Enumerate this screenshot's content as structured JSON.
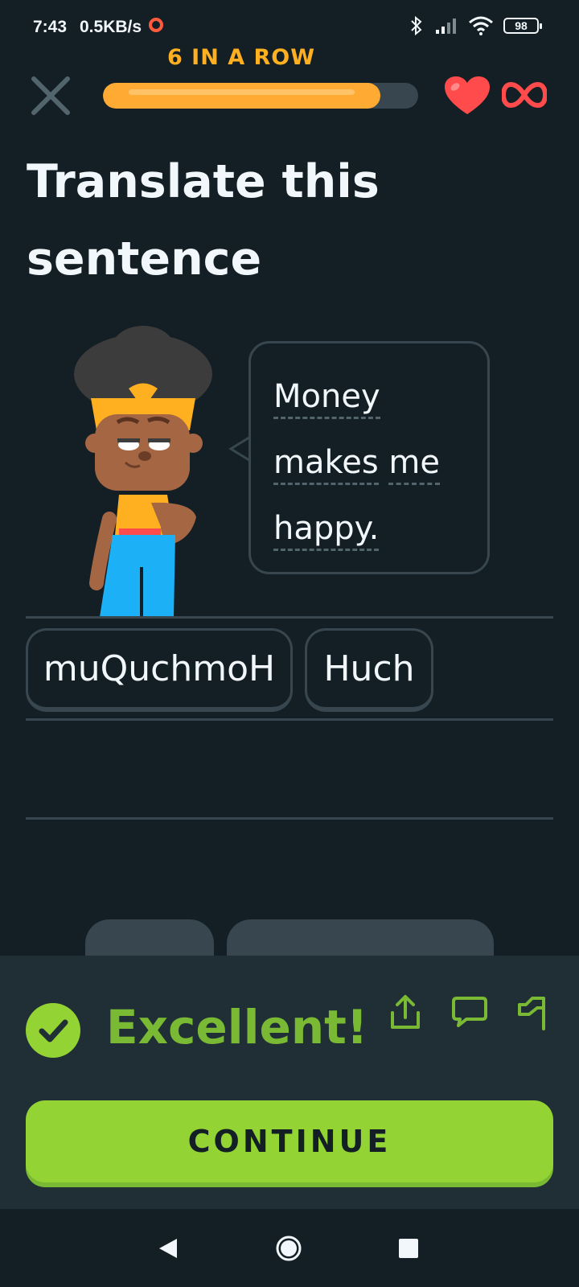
{
  "status_bar": {
    "time": "7:43",
    "network_speed": "0.5KB/s",
    "battery_level": "98",
    "icons": [
      "bluetooth-icon",
      "signal-icon",
      "wifi-icon",
      "battery-icon"
    ]
  },
  "header": {
    "streak_text": "6 IN A ROW",
    "progress_fraction": 0.88,
    "lives": "infinite"
  },
  "exercise": {
    "title": "Translate this sentence",
    "prompt_words": [
      "Money",
      "makes",
      "me",
      "happy."
    ],
    "answer_tiles": [
      "muQuchmoH",
      "Huch"
    ]
  },
  "feedback": {
    "message": "Excellent!",
    "continue_label": "CONTINUE",
    "icons": [
      "share-icon",
      "comment-icon",
      "report-flag-icon"
    ]
  },
  "colors": {
    "background": "#131f24",
    "accent_green": "#93d333",
    "streak_orange": "#ffb020",
    "heart_red": "#ff4b4b"
  }
}
